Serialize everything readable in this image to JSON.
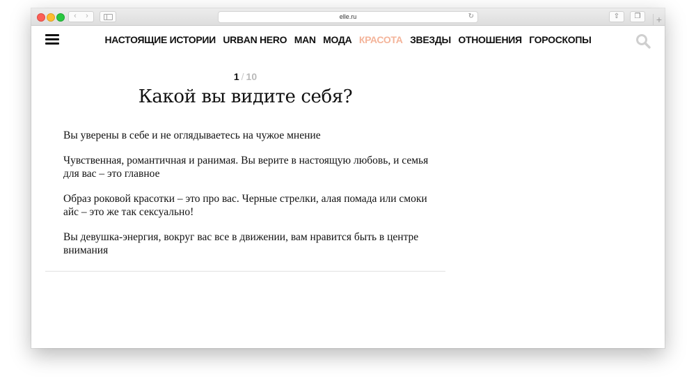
{
  "browser": {
    "url": "elle.ru",
    "back_glyph": "‹",
    "forward_glyph": "›",
    "reload_glyph": "↻",
    "share_glyph": "⇧",
    "tabs_glyph": "❐",
    "newtab_glyph": "+"
  },
  "nav": {
    "items": [
      {
        "label": "НАСТОЯЩИЕ ИСТОРИИ"
      },
      {
        "label": "URBAN HERO"
      },
      {
        "label": "MAN"
      },
      {
        "label": "МОДА"
      },
      {
        "label": "КРАСОТА"
      },
      {
        "label": "ЗВЕЗДЫ"
      },
      {
        "label": "ОТНОШЕНИЯ"
      },
      {
        "label": "ГОРОСКОПЫ"
      }
    ],
    "active_index": 4,
    "active_color": "#f4b49a"
  },
  "quiz": {
    "current": "1",
    "separator": "/",
    "total": "10",
    "question": "Какой вы видите себя?",
    "answers": [
      {
        "text": "Вы уверены в себе и не оглядываетесь на чужое мнение"
      },
      {
        "text": "Чувственная, романтичная и ранимая. Вы верите в настоящую любовь, и семья для вас – это главное"
      },
      {
        "text": "Образ роковой красотки – это про вас. Черные стрелки, алая помада или смоки айс – это же так сексуально!"
      },
      {
        "text": "Вы девушка-энергия, вокруг вас все в движении, вам нравится быть в центре внимания"
      }
    ]
  },
  "icons": {
    "menu": "hamburger-icon",
    "search": "search-icon"
  }
}
